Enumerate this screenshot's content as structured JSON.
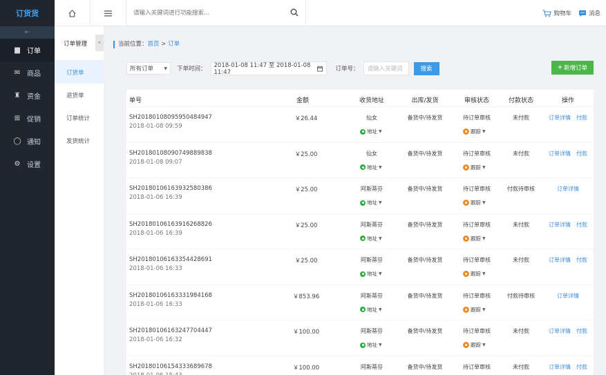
{
  "app": {
    "logo": "订货货"
  },
  "nav": [
    {
      "label": "订单",
      "icon": "document-icon",
      "glyph": "▆",
      "active": true
    },
    {
      "label": "商品",
      "icon": "box-icon",
      "glyph": "✉",
      "active": false
    },
    {
      "label": "资金",
      "icon": "money-bag-icon",
      "glyph": "♜",
      "active": false
    },
    {
      "label": "促销",
      "icon": "gift-icon",
      "glyph": "⊞",
      "active": false
    },
    {
      "label": "通知",
      "icon": "chat-icon",
      "glyph": "◯",
      "active": false
    },
    {
      "label": "设置",
      "icon": "gear-icon",
      "glyph": "⚙",
      "active": false
    }
  ],
  "topbar": {
    "search_placeholder": "请输入关键词进行功能搜索...",
    "cart_label": "购物车",
    "message_label": "消息"
  },
  "submenu": {
    "title": "订单管理",
    "items": [
      {
        "label": "订货单",
        "active": true
      },
      {
        "label": "退货单",
        "active": false
      },
      {
        "label": "订单统计",
        "active": false
      },
      {
        "label": "发货统计",
        "active": false
      }
    ]
  },
  "breadcrumb": {
    "prefix": "当前位置：",
    "home": "首页",
    "sep": ">",
    "current": "订单"
  },
  "filters": {
    "status_select": "所有订单",
    "time_label": "下单时间：",
    "date_range": "2018-01-08 11:47 至 2018-01-08 11:47",
    "order_no_label": "订单号：",
    "keyword_placeholder": "请输入关键词",
    "search_button": "搜索",
    "new_button": "新增订单"
  },
  "table": {
    "headers": [
      "单号",
      "金额",
      "收货地址",
      "出库/发货",
      "审核状态",
      "付款状态",
      "操作"
    ],
    "address_link": "地址",
    "track_link": "跟踪",
    "detail_link": "订单详情",
    "pay_link": "付款",
    "rows": [
      {
        "no": "SH20180108095950484947",
        "time": "2018-01-08 09:59",
        "amount": "￥26.44",
        "addr": "仙女",
        "ship": "备货中/待发货",
        "audit": "待订单审核",
        "pay": "未付款",
        "show_pay": true
      },
      {
        "no": "SH20180108090749889838",
        "time": "2018-01-08 09:07",
        "amount": "￥25.00",
        "addr": "仙女",
        "ship": "备货中/待发货",
        "audit": "待订单审核",
        "pay": "未付款",
        "show_pay": true
      },
      {
        "no": "SH20180106163932580386",
        "time": "2018-01-06 16:39",
        "amount": "￥25.00",
        "addr": "阿斯蒂芬",
        "ship": "备货中/待发货",
        "audit": "待订单审核",
        "pay": "付款待审核",
        "show_pay": false
      },
      {
        "no": "SH20180106163916268826",
        "time": "2018-01-06 16:39",
        "amount": "￥25.00",
        "addr": "阿斯蒂芬",
        "ship": "备货中/待发货",
        "audit": "待订单审核",
        "pay": "未付款",
        "show_pay": true
      },
      {
        "no": "SH20180106163354428691",
        "time": "2018-01-06 16:33",
        "amount": "￥25.00",
        "addr": "阿斯蒂芬",
        "ship": "备货中/待发货",
        "audit": "待订单审核",
        "pay": "未付款",
        "show_pay": true
      },
      {
        "no": "SH20180106163331984168",
        "time": "2018-01-06 16:33",
        "amount": "￥853.96",
        "addr": "阿斯蒂芬",
        "ship": "备货中/待发货",
        "audit": "待订单审核",
        "pay": "付款待审核",
        "show_pay": false
      },
      {
        "no": "SH20180106163247704447",
        "time": "2018-01-06 16:32",
        "amount": "￥100.00",
        "addr": "阿斯蒂芬",
        "ship": "备货中/待发货",
        "audit": "待订单审核",
        "pay": "未付款",
        "show_pay": true
      },
      {
        "no": "SH20180106154333689678",
        "time": "2018-01-06 15:43",
        "amount": "￥100.00",
        "addr": "阿斯蒂芬",
        "ship": "备货中/待发货",
        "audit": "待订单审核",
        "pay": "未付款",
        "show_pay": true
      }
    ]
  },
  "colors": {
    "accent": "#3b8fe0",
    "sidebar": "#20252e",
    "green": "#4cb749",
    "orange": "#f08a24"
  }
}
